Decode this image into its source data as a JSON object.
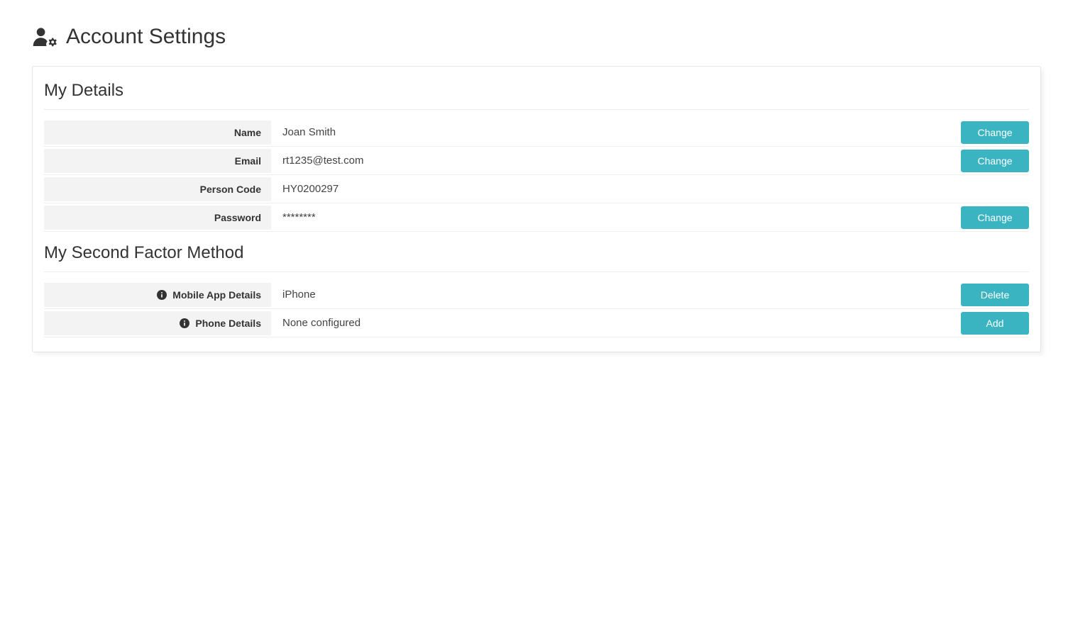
{
  "page": {
    "title": "Account Settings"
  },
  "sections": {
    "details": {
      "title": "My Details",
      "rows": {
        "name": {
          "label": "Name",
          "value": "Joan Smith",
          "action": "Change"
        },
        "email": {
          "label": "Email",
          "value": "rt1235@test.com",
          "action": "Change"
        },
        "personCode": {
          "label": "Person Code",
          "value": "HY0200297"
        },
        "password": {
          "label": "Password",
          "value": "********",
          "action": "Change"
        }
      }
    },
    "secondFactor": {
      "title": "My Second Factor Method",
      "rows": {
        "mobileApp": {
          "label": "Mobile App Details",
          "value": "iPhone",
          "action": "Delete"
        },
        "phone": {
          "label": "Phone Details",
          "value": "None configured",
          "action": "Add"
        }
      }
    }
  }
}
